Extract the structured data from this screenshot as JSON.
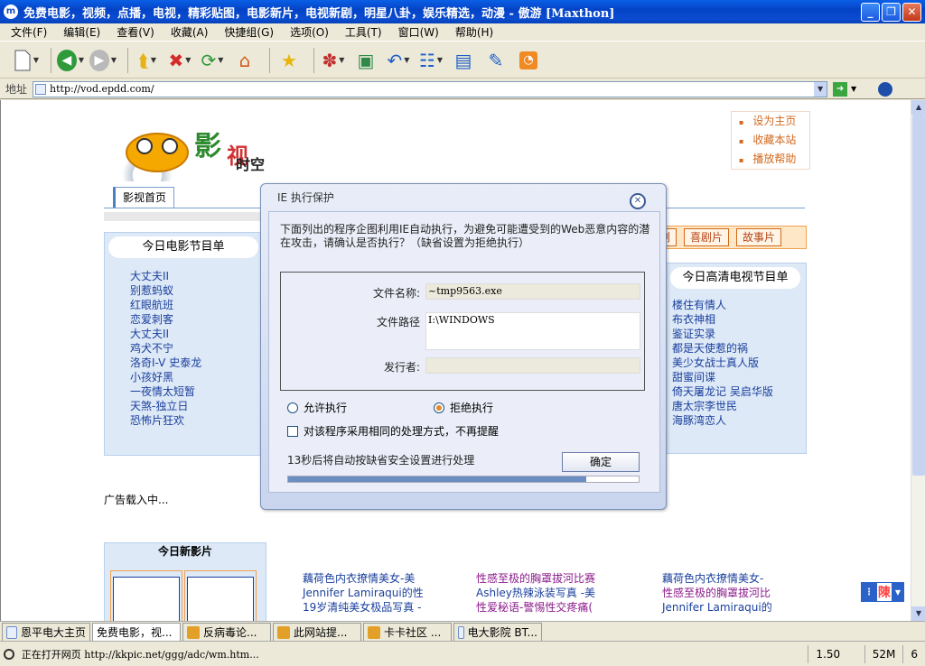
{
  "window": {
    "title": "免费电影，视频，点播，电视，精彩贴图，电影新片，电视新剧，明星八卦，娱乐精选，动漫 - 傲游 [Maxthon]",
    "app_icon_glyph": "m"
  },
  "menu": [
    "文件(F)",
    "编辑(E)",
    "查看(V)",
    "收藏(A)",
    "快捷组(G)",
    "选项(O)",
    "工具(T)",
    "窗口(W)",
    "帮助(H)"
  ],
  "address": {
    "label": "地址",
    "url": "http://vod.epdd.com/"
  },
  "site": {
    "logo_a": "影",
    "logo_b": "视",
    "logo_c": "时空",
    "quicklinks": [
      "设为主页",
      "收藏本站",
      "播放帮助"
    ],
    "nav_tab": "影视首页",
    "orange_buttons": [
      "剧",
      "喜剧片",
      "故事片"
    ],
    "movie_panel_title": "今日电影节目单",
    "movie_list": [
      "大丈夫II",
      "别惹蚂蚁",
      "红眼航班",
      "恋爱刺客",
      "大丈夫II",
      "鸡犬不宁",
      "洛奇I-V 史泰龙",
      "小孩好黑",
      "一夜情太短暂",
      "天煞-独立日",
      "恐怖片狂欢"
    ],
    "tv_panel_title": "今日高清电视节目单",
    "tv_list": [
      "楼住有情人",
      "布衣神相",
      "鉴证实录",
      "都是天使惹的祸",
      "美少女战士真人版",
      "甜蜜间谍",
      "倚天屠龙记 吴启华版",
      "唐太宗李世民",
      "海豚湾恋人"
    ],
    "ad_text": "广告载入中...",
    "new_panel_title": "今日新影片",
    "news_col1": [
      "藕荷色内衣撩情美女-美",
      "Jennifer Lamiraqui的性",
      "19岁清纯美女极品写真 -"
    ],
    "news_col2": [
      "性感至极的胸罩拔河比赛",
      "Ashley热辣泳装写真 -美",
      "性爱秘语-警惕性交疼痛("
    ],
    "news_col3": [
      "藕荷色内衣撩情美女-",
      "性感至极的胸罩拔河比",
      "Jennifer Lamiraqui的"
    ],
    "float_char": "陳"
  },
  "dialog": {
    "title": "IE 执行保护",
    "description": "下面列出的程序企图利用IE自动执行，为避免可能遭受到的Web恶意内容的潜在攻击，请确认是否执行？（缺省设置为拒绝执行）",
    "file_name_label": "文件名称:",
    "file_name_value": "~tmp9563.exe",
    "file_path_label": "文件路径",
    "file_path_value": "I:\\WINDOWS",
    "publisher_label": "发行者:",
    "publisher_value": "",
    "allow_label": "允许执行",
    "deny_label": "拒绝执行",
    "remember_label": "对该程序采用相同的处理方式，不再提醒",
    "countdown_text": "13秒后将自动按缺省安全设置进行处理",
    "ok_label": "确定",
    "progress_fraction": 0.85
  },
  "tabs": [
    {
      "label": "恩平电大主页",
      "active": false,
      "icon": "page"
    },
    {
      "label": "免费电影，视...",
      "active": true,
      "icon": "fav"
    },
    {
      "label": "反病毒论...",
      "active": false,
      "icon": "fav"
    },
    {
      "label": "此网站提...",
      "active": false,
      "icon": "fav"
    },
    {
      "label": "卡卡社区 ...",
      "active": false,
      "icon": "fav"
    },
    {
      "label": "电大影院 BT...",
      "active": false,
      "icon": "page"
    }
  ],
  "status": {
    "text": "正在打开网页 http://kkpic.net/ggg/adc/wm.htm...",
    "size": "1.50 KB",
    "memory": "52M",
    "count": "6"
  }
}
